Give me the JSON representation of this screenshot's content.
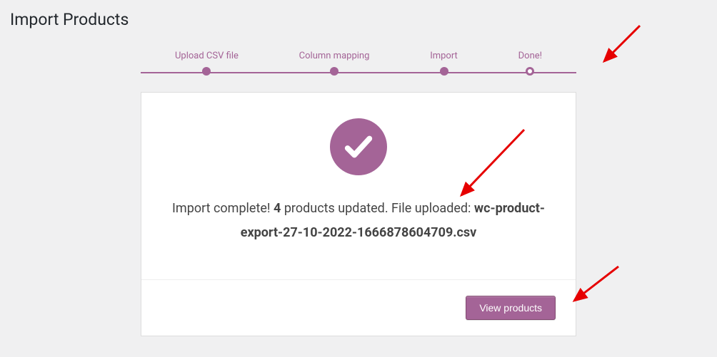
{
  "page_title": "Import Products",
  "steps": [
    {
      "label": "Upload CSV file",
      "active": false
    },
    {
      "label": "Column mapping",
      "active": false
    },
    {
      "label": "Import",
      "active": false
    },
    {
      "label": "Done!",
      "active": true
    }
  ],
  "result": {
    "prefix": "Import complete! ",
    "count": "4",
    "mid": " products updated. File uploaded: ",
    "filename": "wc-product-export-27-10-2022-1666878604709.csv"
  },
  "actions": {
    "view_products": "View products"
  },
  "colors": {
    "accent": "#a46497"
  }
}
